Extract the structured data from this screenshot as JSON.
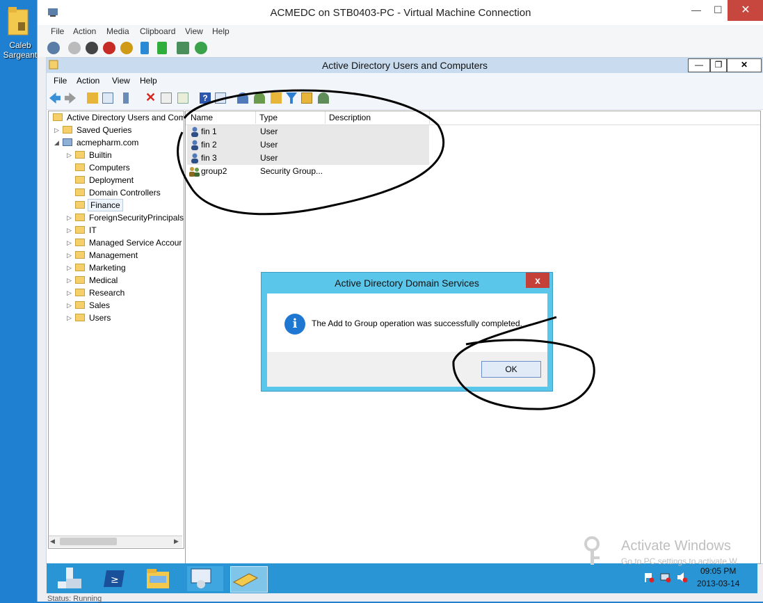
{
  "desktop": {
    "icon_label_line1": "Caleb",
    "icon_label_line2": "Sargeant"
  },
  "vm_window": {
    "title": "ACMEDC on STB0403-PC - Virtual Machine Connection",
    "menu": [
      "File",
      "Action",
      "Media",
      "Clipboard",
      "View",
      "Help"
    ],
    "status": "Status: Running"
  },
  "mmc": {
    "title": "Active Directory Users and Computers",
    "menu": [
      "File",
      "Action",
      "View",
      "Help"
    ],
    "tree": {
      "root": "Active Directory Users and Com",
      "saved_queries": "Saved Queries",
      "domain": "acmepharm.com",
      "children": [
        "Builtin",
        "Computers",
        "Deployment",
        "Domain Controllers",
        "Finance",
        "ForeignSecurityPrincipals",
        "IT",
        "Managed Service Accour",
        "Management",
        "Marketing",
        "Medical",
        "Research",
        "Sales",
        "Users"
      ],
      "selected": "Finance"
    },
    "list": {
      "columns": [
        "Name",
        "Type",
        "Description"
      ],
      "rows": [
        {
          "name": "fin 1",
          "type": "User",
          "description": ""
        },
        {
          "name": "fin 2",
          "type": "User",
          "description": ""
        },
        {
          "name": "fin 3",
          "type": "User",
          "description": ""
        },
        {
          "name": "group2",
          "type": "Security Group...",
          "description": ""
        }
      ]
    }
  },
  "dialog": {
    "title": "Active Directory Domain Services",
    "close_label": "x",
    "message": "The Add to Group operation was successfully completed.",
    "ok_label": "OK",
    "icon": "info-icon"
  },
  "taskbar": {
    "time": "09:05 PM",
    "date": "2013-03-14"
  },
  "watermark": {
    "line1": "Activate Windows",
    "line2": "Go to PC settings to activate W"
  }
}
